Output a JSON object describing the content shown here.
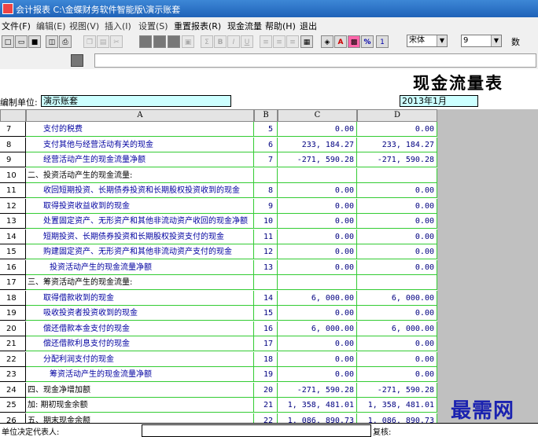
{
  "window": {
    "title": "会计报表   C:\\金蝶财务软件智能版\\演示账套"
  },
  "menu": [
    "文件(F)",
    "编辑(E)",
    "视图(V)",
    "插入(I)",
    "设置(S)",
    "重置报表(R)",
    "现金流量",
    "帮助(H)",
    "退出"
  ],
  "toolbar": {
    "buttons": [
      "new",
      "open",
      "save",
      "preview",
      "print",
      "copy",
      "paste",
      "cut",
      "bold-box",
      "merge",
      "fill",
      "sum",
      "B",
      "I",
      "U",
      "align-left",
      "align-center",
      "align-right",
      "format",
      "color",
      "font-color",
      "bg",
      "percent",
      "decimal"
    ],
    "font_name": "宋体",
    "font_size": "9",
    "extra": "数"
  },
  "report": {
    "title": "现金流量表",
    "unit_label": "编制单位:",
    "unit_value": "演示账套",
    "date_value": "2013年1月",
    "columns": [
      "A",
      "B",
      "C",
      "D"
    ],
    "rows": [
      {
        "num": "7",
        "a": "支付的税费",
        "b": "5",
        "c": "0.00",
        "d": "0.00",
        "indent": 2
      },
      {
        "num": "8",
        "a": "支付其他与经营活动有关的现金",
        "b": "6",
        "c": "233, 184.27",
        "d": "233, 184.27",
        "indent": 2
      },
      {
        "num": "9",
        "a": "经营活动产生的现金流量净额",
        "b": "7",
        "c": "-271, 590.28",
        "d": "-271, 590.28",
        "indent": 2
      },
      {
        "num": "10",
        "a": "二、投资活动产生的现金流量:",
        "b": "",
        "c": "",
        "d": "",
        "indent": 0
      },
      {
        "num": "11",
        "a": "收回短期投资、长期债券投资和长期股权投资收到的现金",
        "b": "8",
        "c": "0.00",
        "d": "0.00",
        "indent": 2
      },
      {
        "num": "12",
        "a": "取得投资收益收到的现金",
        "b": "9",
        "c": "0.00",
        "d": "0.00",
        "indent": 2
      },
      {
        "num": "13",
        "a": "处置固定资产、无形资产和其他非流动资产收回的现金净额",
        "b": "10",
        "c": "0.00",
        "d": "0.00",
        "indent": 2
      },
      {
        "num": "14",
        "a": "短期投资、长期债券投资和长期股权投资支付的现金",
        "b": "11",
        "c": "0.00",
        "d": "0.00",
        "indent": 2
      },
      {
        "num": "15",
        "a": "购建固定资产、无形资产和其他非流动资产支付的现金",
        "b": "12",
        "c": "0.00",
        "d": "0.00",
        "indent": 2
      },
      {
        "num": "16",
        "a": "投资活动产生的现金流量净额",
        "b": "13",
        "c": "0.00",
        "d": "0.00",
        "indent": 3
      },
      {
        "num": "17",
        "a": "三、筹资活动产生的现金流量:",
        "b": "",
        "c": "",
        "d": "",
        "indent": 0
      },
      {
        "num": "18",
        "a": "取得借款收到的现金",
        "b": "14",
        "c": "6, 000.00",
        "d": "6, 000.00",
        "indent": 2
      },
      {
        "num": "19",
        "a": "吸收投资者投资收到的现金",
        "b": "15",
        "c": "0.00",
        "d": "0.00",
        "indent": 2
      },
      {
        "num": "20",
        "a": "偿还借款本金支付的现金",
        "b": "16",
        "c": "6, 000.00",
        "d": "6, 000.00",
        "indent": 2
      },
      {
        "num": "21",
        "a": "偿还借款利息支付的现金",
        "b": "17",
        "c": "0.00",
        "d": "0.00",
        "indent": 2
      },
      {
        "num": "22",
        "a": "分配利润支付的现金",
        "b": "18",
        "c": "0.00",
        "d": "0.00",
        "indent": 2
      },
      {
        "num": "23",
        "a": "筹资活动产生的现金流量净额",
        "b": "19",
        "c": "0.00",
        "d": "0.00",
        "indent": 3
      },
      {
        "num": "24",
        "a": "四、现金净增加额",
        "b": "20",
        "c": "-271, 590.28",
        "d": "-271, 590.28",
        "indent": 0
      },
      {
        "num": "25",
        "a": "加: 期初现金余额",
        "b": "21",
        "c": "1, 358, 481.01",
        "d": "1, 358, 481.01",
        "indent": 0
      },
      {
        "num": "26",
        "a": "五、期末现金余额",
        "b": "22",
        "c": "1, 086, 890.73",
        "d": "1, 086, 890.73",
        "indent": 0
      }
    ]
  },
  "footer": {
    "left": "单位决定代表人:",
    "right": "复核:"
  },
  "watermark": "最需网",
  "colors": {
    "title_bar": "#1f62b8",
    "cell_input": "#ccffff",
    "grid_line": "#33cc33",
    "value_text": "#000080"
  }
}
